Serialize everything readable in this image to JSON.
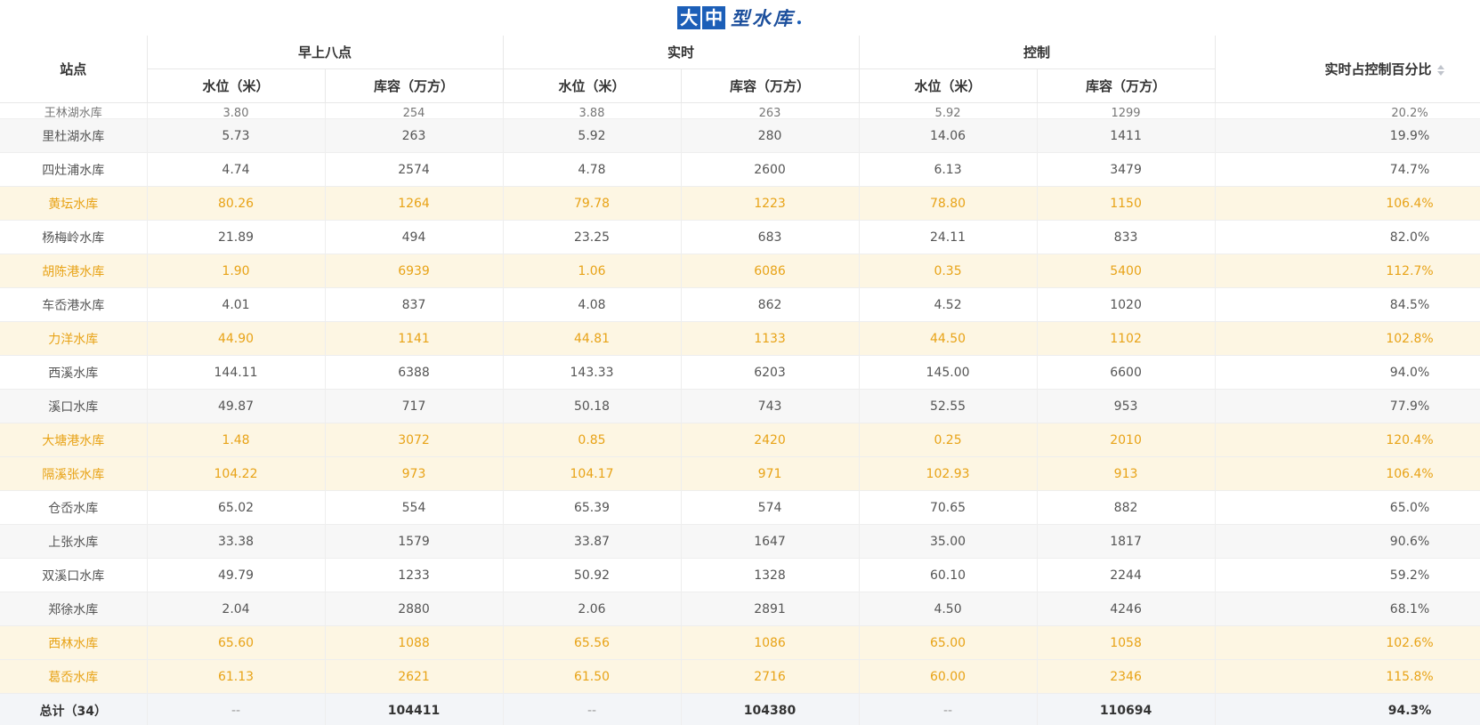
{
  "title": {
    "box1": "大",
    "box2": "中",
    "rest": "型水库",
    "dot": "."
  },
  "header": {
    "station": "站点",
    "group_morning": "早上八点",
    "group_realtime": "实时",
    "group_control": "控制",
    "pct": "实时占控制百分比",
    "sub_level": "水位（米）",
    "sub_capacity": "库容（万方）"
  },
  "rows": [
    {
      "name": "王林湖水库",
      "m_level": "3.80",
      "m_cap": "254",
      "r_level": "3.88",
      "r_cap": "263",
      "c_level": "5.92",
      "c_cap": "1299",
      "pct": "20.2%",
      "style": "partial"
    },
    {
      "name": "里杜湖水库",
      "m_level": "5.73",
      "m_cap": "263",
      "r_level": "5.92",
      "r_cap": "280",
      "c_level": "14.06",
      "c_cap": "1411",
      "pct": "19.9%",
      "style": "alt"
    },
    {
      "name": "四灶浦水库",
      "m_level": "4.74",
      "m_cap": "2574",
      "r_level": "4.78",
      "r_cap": "2600",
      "c_level": "6.13",
      "c_cap": "3479",
      "pct": "74.7%",
      "style": "normal"
    },
    {
      "name": "黄坛水库",
      "m_level": "80.26",
      "m_cap": "1264",
      "r_level": "79.78",
      "r_cap": "1223",
      "c_level": "78.80",
      "c_cap": "1150",
      "pct": "106.4%",
      "style": "warn"
    },
    {
      "name": "杨梅岭水库",
      "m_level": "21.89",
      "m_cap": "494",
      "r_level": "23.25",
      "r_cap": "683",
      "c_level": "24.11",
      "c_cap": "833",
      "pct": "82.0%",
      "style": "normal"
    },
    {
      "name": "胡陈港水库",
      "m_level": "1.90",
      "m_cap": "6939",
      "r_level": "1.06",
      "r_cap": "6086",
      "c_level": "0.35",
      "c_cap": "5400",
      "pct": "112.7%",
      "style": "warn"
    },
    {
      "name": "车岙港水库",
      "m_level": "4.01",
      "m_cap": "837",
      "r_level": "4.08",
      "r_cap": "862",
      "c_level": "4.52",
      "c_cap": "1020",
      "pct": "84.5%",
      "style": "normal"
    },
    {
      "name": "力洋水库",
      "m_level": "44.90",
      "m_cap": "1141",
      "r_level": "44.81",
      "r_cap": "1133",
      "c_level": "44.50",
      "c_cap": "1102",
      "pct": "102.8%",
      "style": "warn"
    },
    {
      "name": "西溪水库",
      "m_level": "144.11",
      "m_cap": "6388",
      "r_level": "143.33",
      "r_cap": "6203",
      "c_level": "145.00",
      "c_cap": "6600",
      "pct": "94.0%",
      "style": "normal"
    },
    {
      "name": "溪口水库",
      "m_level": "49.87",
      "m_cap": "717",
      "r_level": "50.18",
      "r_cap": "743",
      "c_level": "52.55",
      "c_cap": "953",
      "pct": "77.9%",
      "style": "alt"
    },
    {
      "name": "大塘港水库",
      "m_level": "1.48",
      "m_cap": "3072",
      "r_level": "0.85",
      "r_cap": "2420",
      "c_level": "0.25",
      "c_cap": "2010",
      "pct": "120.4%",
      "style": "warn"
    },
    {
      "name": "隔溪张水库",
      "m_level": "104.22",
      "m_cap": "973",
      "r_level": "104.17",
      "r_cap": "971",
      "c_level": "102.93",
      "c_cap": "913",
      "pct": "106.4%",
      "style": "warn"
    },
    {
      "name": "仓岙水库",
      "m_level": "65.02",
      "m_cap": "554",
      "r_level": "65.39",
      "r_cap": "574",
      "c_level": "70.65",
      "c_cap": "882",
      "pct": "65.0%",
      "style": "normal"
    },
    {
      "name": "上张水库",
      "m_level": "33.38",
      "m_cap": "1579",
      "r_level": "33.87",
      "r_cap": "1647",
      "c_level": "35.00",
      "c_cap": "1817",
      "pct": "90.6%",
      "style": "alt"
    },
    {
      "name": "双溪口水库",
      "m_level": "49.79",
      "m_cap": "1233",
      "r_level": "50.92",
      "r_cap": "1328",
      "c_level": "60.10",
      "c_cap": "2244",
      "pct": "59.2%",
      "style": "normal"
    },
    {
      "name": "郑徐水库",
      "m_level": "2.04",
      "m_cap": "2880",
      "r_level": "2.06",
      "r_cap": "2891",
      "c_level": "4.50",
      "c_cap": "4246",
      "pct": "68.1%",
      "style": "alt"
    },
    {
      "name": "西林水库",
      "m_level": "65.60",
      "m_cap": "1088",
      "r_level": "65.56",
      "r_cap": "1086",
      "c_level": "65.00",
      "c_cap": "1058",
      "pct": "102.6%",
      "style": "warn"
    },
    {
      "name": "葛岙水库",
      "m_level": "61.13",
      "m_cap": "2621",
      "r_level": "61.50",
      "r_cap": "2716",
      "c_level": "60.00",
      "c_cap": "2346",
      "pct": "115.8%",
      "style": "warn"
    }
  ],
  "total": {
    "name": "总计（34）",
    "m_level": "--",
    "m_cap": "104411",
    "r_level": "--",
    "r_cap": "104380",
    "c_level": "--",
    "c_cap": "110694",
    "pct": "94.3%"
  },
  "colors": {
    "warn_text": "#e8a317",
    "warn_bg": "#fdf6e3",
    "logo_blue": "#1c5fb8"
  }
}
